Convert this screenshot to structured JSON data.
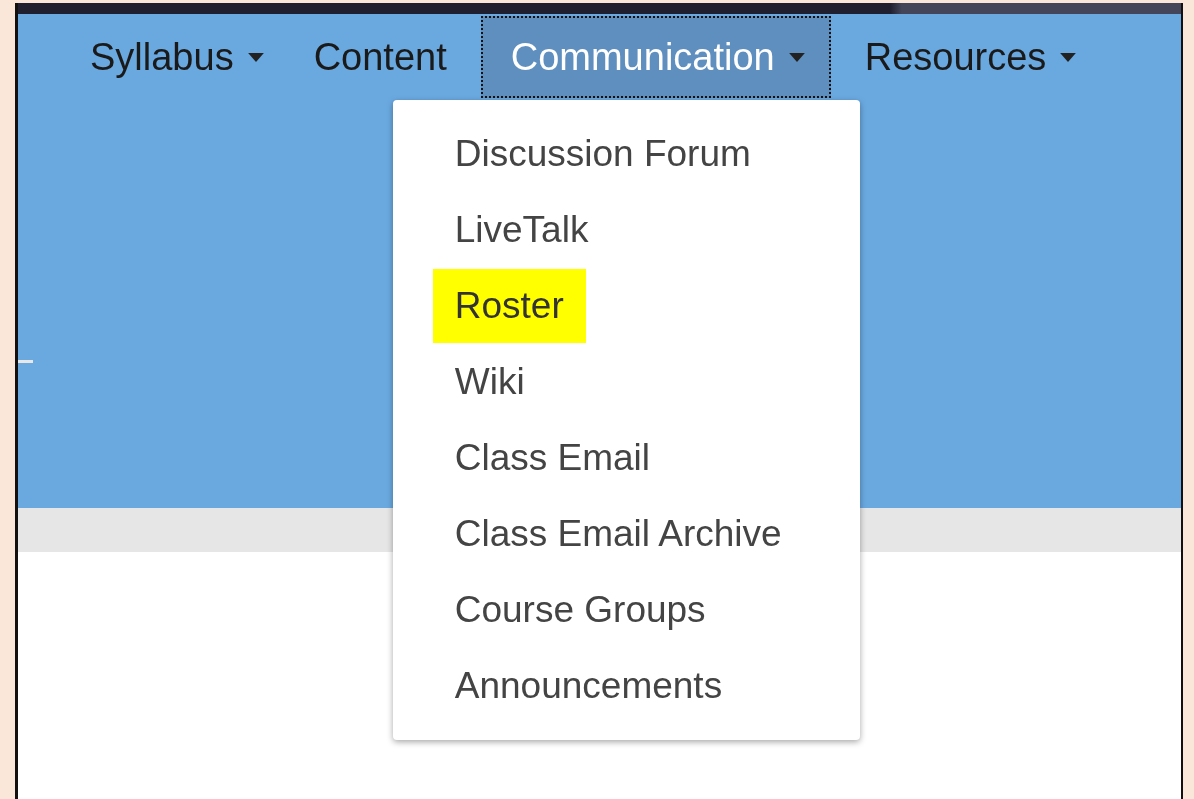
{
  "nav": [
    {
      "label": "Syllabus",
      "dropdown": true,
      "selected": false
    },
    {
      "label": "Content",
      "dropdown": false,
      "selected": false
    },
    {
      "label": "Communication",
      "dropdown": true,
      "selected": true
    },
    {
      "label": "Resources",
      "dropdown": true,
      "selected": false
    }
  ],
  "menu": [
    {
      "label": "Discussion Forum",
      "highlighted": false
    },
    {
      "label": "LiveTalk",
      "highlighted": false
    },
    {
      "label": "Roster",
      "highlighted": true
    },
    {
      "label": "Wiki",
      "highlighted": false
    },
    {
      "label": "Class Email",
      "highlighted": false
    },
    {
      "label": "Class Email Archive",
      "highlighted": false
    },
    {
      "label": "Course Groups",
      "highlighted": false
    },
    {
      "label": "Announcements",
      "highlighted": false
    }
  ]
}
